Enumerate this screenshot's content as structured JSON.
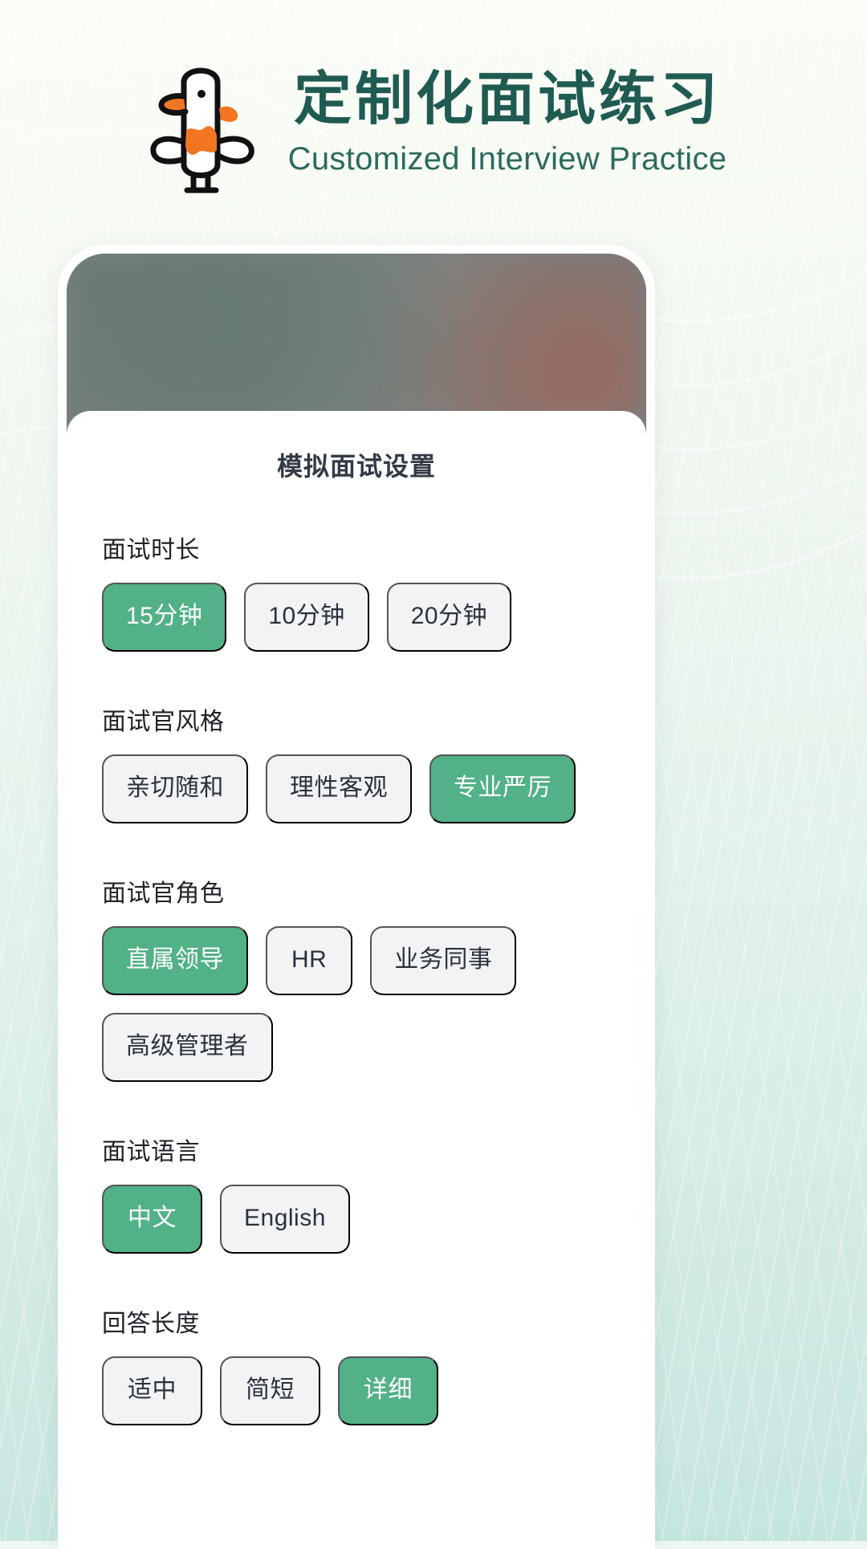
{
  "header": {
    "title_cn": "定制化面试练习",
    "title_en": "Customized Interview Practice",
    "mascot": "duck-mascot",
    "title_color": "#1f5b52",
    "accent_color": "#52b186"
  },
  "phone": {
    "sheet_title": "模拟面试设置",
    "sections": [
      {
        "label": "面试时长",
        "name": "interview-duration",
        "options": [
          {
            "label": "15分钟",
            "selected": true
          },
          {
            "label": "10分钟",
            "selected": false
          },
          {
            "label": "20分钟",
            "selected": false
          }
        ]
      },
      {
        "label": "面试官风格",
        "name": "interviewer-style",
        "options": [
          {
            "label": "亲切随和",
            "selected": false
          },
          {
            "label": "理性客观",
            "selected": false
          },
          {
            "label": "专业严厉",
            "selected": true
          }
        ]
      },
      {
        "label": "面试官角色",
        "name": "interviewer-role",
        "options": [
          {
            "label": "直属领导",
            "selected": true
          },
          {
            "label": "HR",
            "selected": false
          },
          {
            "label": "业务同事",
            "selected": false
          },
          {
            "label": "高级管理者",
            "selected": false
          }
        ]
      },
      {
        "label": "面试语言",
        "name": "interview-language",
        "options": [
          {
            "label": "中文",
            "selected": true
          },
          {
            "label": "English",
            "selected": false
          }
        ]
      },
      {
        "label": "回答长度",
        "name": "answer-length",
        "options": [
          {
            "label": "适中",
            "selected": false
          },
          {
            "label": "简短",
            "selected": false
          },
          {
            "label": "详细",
            "selected": true
          }
        ]
      }
    ]
  }
}
